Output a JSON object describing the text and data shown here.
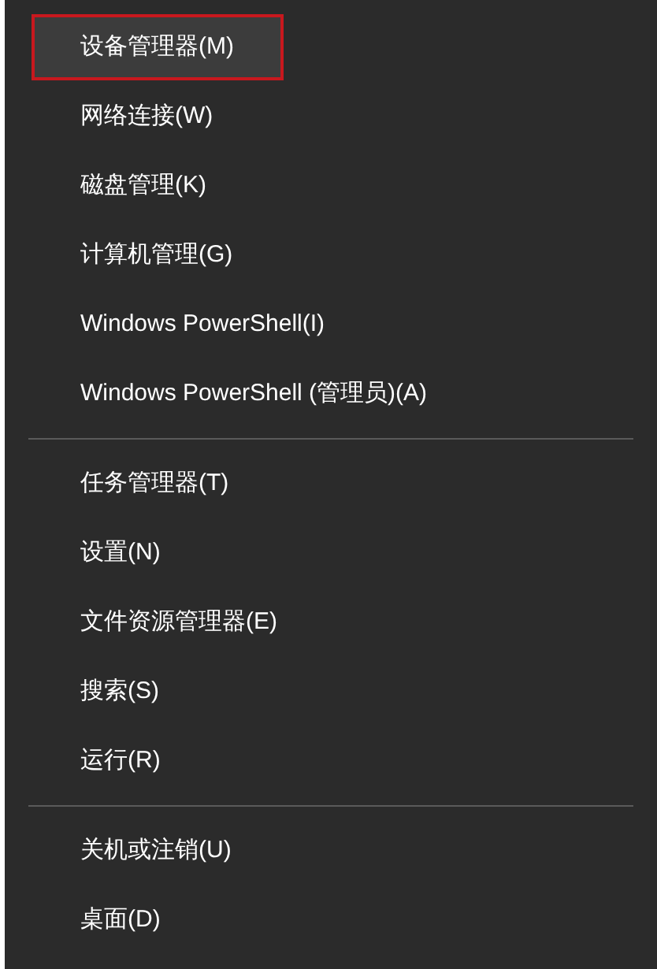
{
  "menu": {
    "groups": [
      {
        "items": [
          {
            "label": "设备管理器(M)",
            "highlighted": true
          },
          {
            "label": "网络连接(W)",
            "highlighted": false
          },
          {
            "label": "磁盘管理(K)",
            "highlighted": false
          },
          {
            "label": "计算机管理(G)",
            "highlighted": false
          },
          {
            "label": "Windows PowerShell(I)",
            "highlighted": false
          },
          {
            "label": "Windows PowerShell (管理员)(A)",
            "highlighted": false
          }
        ]
      },
      {
        "items": [
          {
            "label": "任务管理器(T)",
            "highlighted": false
          },
          {
            "label": "设置(N)",
            "highlighted": false
          },
          {
            "label": "文件资源管理器(E)",
            "highlighted": false
          },
          {
            "label": "搜索(S)",
            "highlighted": false
          },
          {
            "label": "运行(R)",
            "highlighted": false
          }
        ]
      },
      {
        "items": [
          {
            "label": "关机或注销(U)",
            "highlighted": false
          },
          {
            "label": "桌面(D)",
            "highlighted": false
          }
        ]
      }
    ]
  }
}
